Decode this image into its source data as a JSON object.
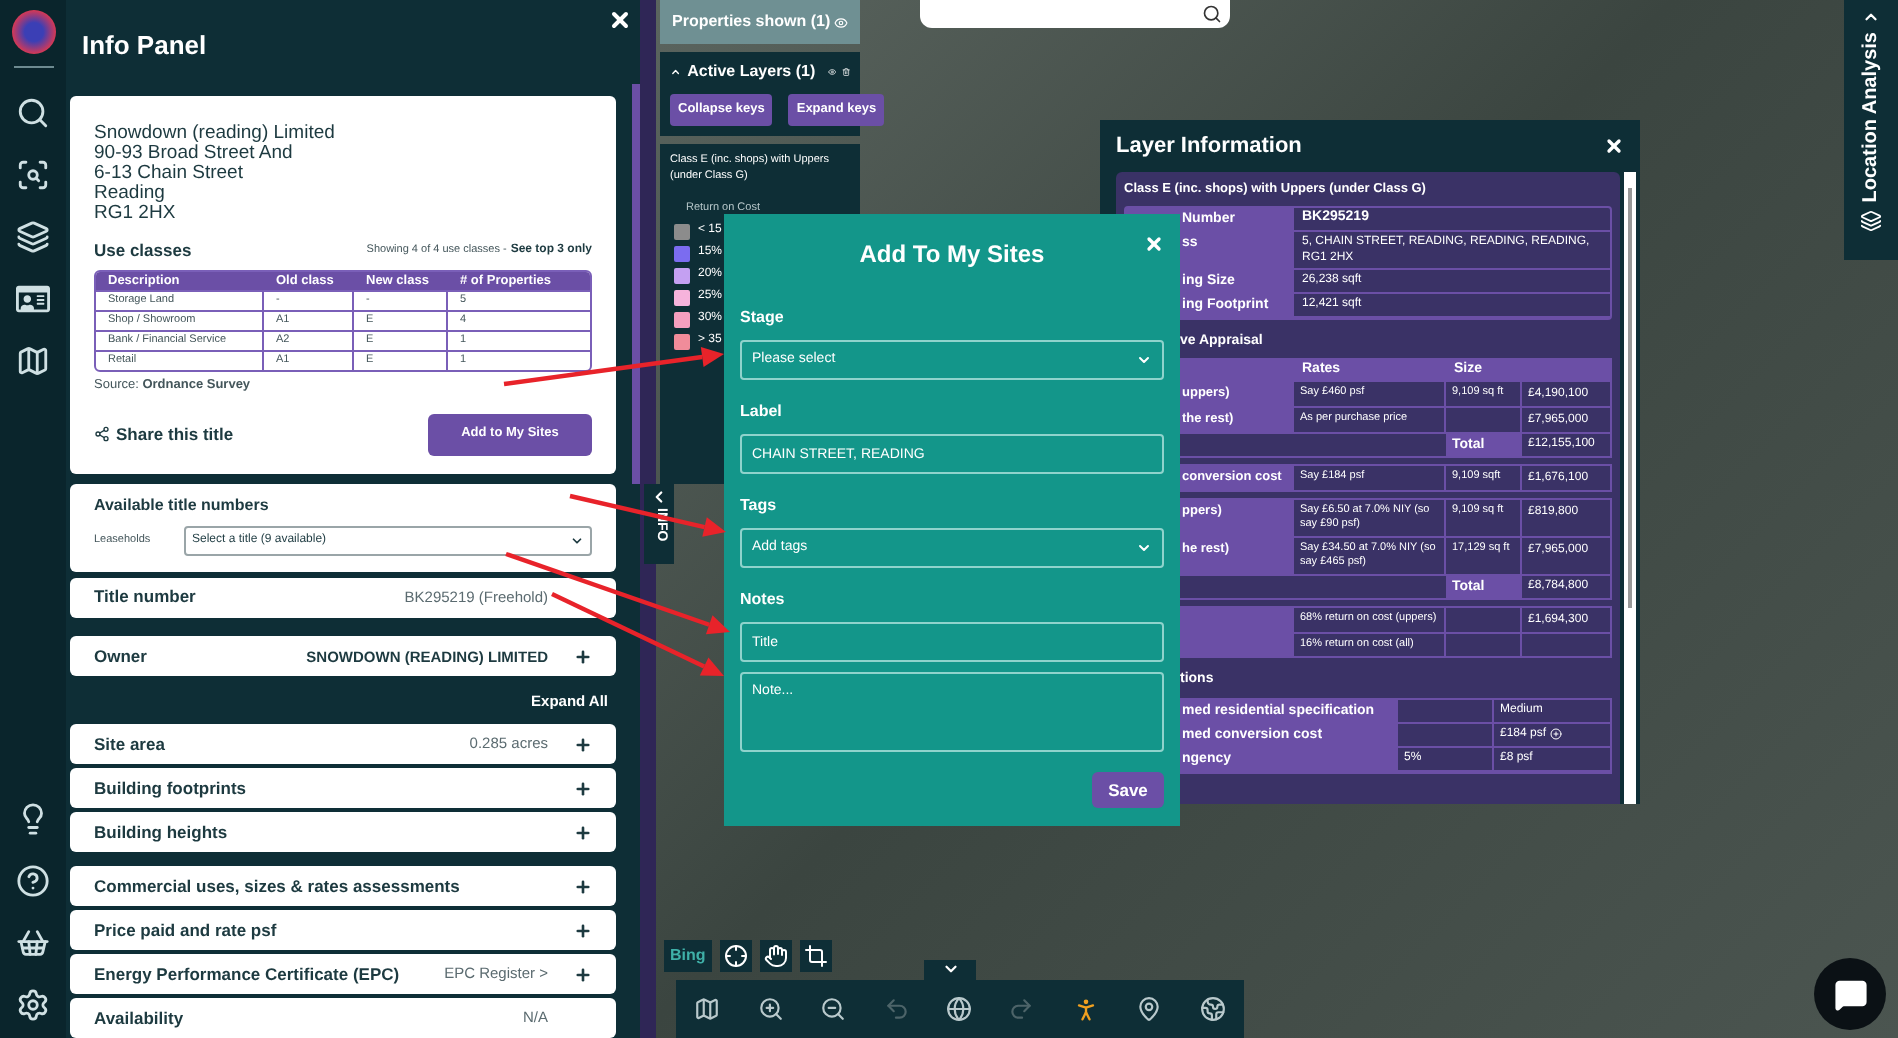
{
  "info_panel": {
    "title": "Info Panel",
    "address_lines": [
      "Snowdown (reading) Limited",
      "90-93 Broad Street And",
      "6-13 Chain Street",
      "Reading",
      "RG1 2HX"
    ],
    "use_classes": {
      "title": "Use classes",
      "showing": "Showing 4 of 4 use classes -",
      "see_top": "See top 3 only",
      "columns": [
        "Description",
        "Old class",
        "New class",
        "# of Properties"
      ],
      "rows": [
        [
          "Storage Land",
          "-",
          "-",
          "5"
        ],
        [
          "Shop / Showroom",
          "A1",
          "E",
          "4"
        ],
        [
          "Bank / Financial Service",
          "A2",
          "E",
          "1"
        ],
        [
          "Retail",
          "A1",
          "E",
          "1"
        ]
      ]
    },
    "source": "Source: **Ordnance Survey**",
    "share": "Share this title",
    "add_button": "Add to My Sites"
  },
  "title_numbers": {
    "title": "Available title numbers",
    "label": "Leaseholds",
    "select": "Select a title (9 available)"
  },
  "top_sections": [
    {
      "label": "Title number",
      "value": "BK295219 (Freehold)",
      "value_bold": false,
      "expandable": false
    },
    {
      "label": "Owner",
      "value": "SNOWDOWN (READING) LIMITED",
      "value_bold": true,
      "expandable": true
    }
  ],
  "expand_all": "Expand All",
  "section_groups": [
    [
      {
        "label": "Site area",
        "value": "0.285 acres",
        "expandable": true
      },
      {
        "label": "Building footprints",
        "expandable": true
      },
      {
        "label": "Building heights",
        "expandable": true
      }
    ],
    [
      {
        "label": "Commercial uses, sizes & rates assessments",
        "expandable": true
      },
      {
        "label": "Price paid and rate psf",
        "expandable": true
      },
      {
        "label": "Energy Performance Certificate (EPC)",
        "value": "EPC Register >",
        "expandable": true
      },
      {
        "label": "Availability",
        "value": "N/A",
        "expandable": false
      }
    ]
  ],
  "layers": {
    "properties_shown": "Properties shown (1)",
    "active_layers": {
      "title": "Active Layers (1)",
      "expanded": true,
      "buttons": [
        "Collapse keys",
        "Expand keys"
      ]
    },
    "layer_title": "Class E (inc. shops) with Uppers (under Class G)",
    "legend_title": "Return on Cost",
    "legend": [
      {
        "label": "< 15",
        "color": "#8c8c8c"
      },
      {
        "label": "15%",
        "color": "#7b6cf0"
      },
      {
        "label": "20%",
        "color": "#c4a0f2"
      },
      {
        "label": "25%",
        "color": "#f6b3dc"
      },
      {
        "label": "30%",
        "color": "#f59fbf"
      },
      {
        "label": "> 35",
        "color": "#f08c9a"
      }
    ]
  },
  "info_tab": "INFO",
  "modal": {
    "title": "Add To My Sites",
    "fields": [
      {
        "label": "Stage",
        "kind": "select",
        "placeholder": "Please select"
      },
      {
        "label": "Label",
        "kind": "input",
        "value": "CHAIN STREET, READING"
      },
      {
        "label": "Tags",
        "kind": "select",
        "placeholder": "Add tags"
      },
      {
        "label": "Notes",
        "kind": "input",
        "placeholder": "Title"
      },
      {
        "kind": "textarea",
        "placeholder": "Note..."
      }
    ],
    "save": "Save"
  },
  "layer_info": {
    "title": "Layer Information",
    "subtitle": "Class E (inc. shops) with Uppers (under Class G)",
    "details": [
      {
        "label": "Number",
        "value": "BK295219"
      },
      {
        "label": "ss",
        "value": "5, CHAIN STREET, READING, READING, READING, RG1 2HX"
      },
      {
        "label": "ing Size",
        "value": "26,238 sqft"
      },
      {
        "label": "ing Footprint",
        "value": "12,421 sqft"
      }
    ],
    "appraisal_title": "ve Appraisal",
    "appraisal_columns": [
      "Rates",
      "Size"
    ],
    "appraisal_groups": [
      [
        {
          "kind": "row",
          "label": "uppers)",
          "rate": "Say £460 psf",
          "size": "9,109 sq ft",
          "value": "£4,190,100"
        },
        {
          "kind": "row",
          "label": "the rest)",
          "rate": "As per purchase price",
          "value": "£7,965,000"
        },
        {
          "kind": "total",
          "label": "Total",
          "value": "£12,155,100"
        }
      ],
      [
        {
          "kind": "row",
          "label": "conversion cost",
          "rate": "Say £184 psf",
          "size": "9,109 sqft",
          "value": "£1,676,100"
        }
      ],
      [
        {
          "kind": "row",
          "label": "ppers)",
          "rate": "Say £6.50 at 7.0% NIY (so say £90 psf)",
          "size": "9,109 sq ft",
          "value": "£819,800"
        },
        {
          "kind": "row",
          "label": "he rest)",
          "rate": "Say £34.50 at 7.0% NIY (so say £465 psf)",
          "size": "17,129 sq ft",
          "value": "£7,965,000"
        },
        {
          "kind": "total",
          "label": "Total",
          "value": "£8,784,800"
        }
      ],
      [
        {
          "kind": "row",
          "rate": "68% return on cost (uppers)",
          "value": "£1,694,300"
        },
        {
          "kind": "row",
          "rate": "16% return on cost (all)"
        }
      ]
    ],
    "assumptions_title": "tions",
    "assumptions": [
      {
        "label": "med residential specification",
        "value": "Medium",
        "has_icon": false
      },
      {
        "label": "med conversion cost",
        "value": "£184 psf",
        "has_icon": true
      },
      {
        "label": "ngency",
        "rate": "5%",
        "value": "£8 psf",
        "has_icon": false
      }
    ]
  },
  "location_tab": "Location Analysis",
  "toolbar": {
    "expanded": true
  },
  "map": {
    "logo": "Bing"
  }
}
